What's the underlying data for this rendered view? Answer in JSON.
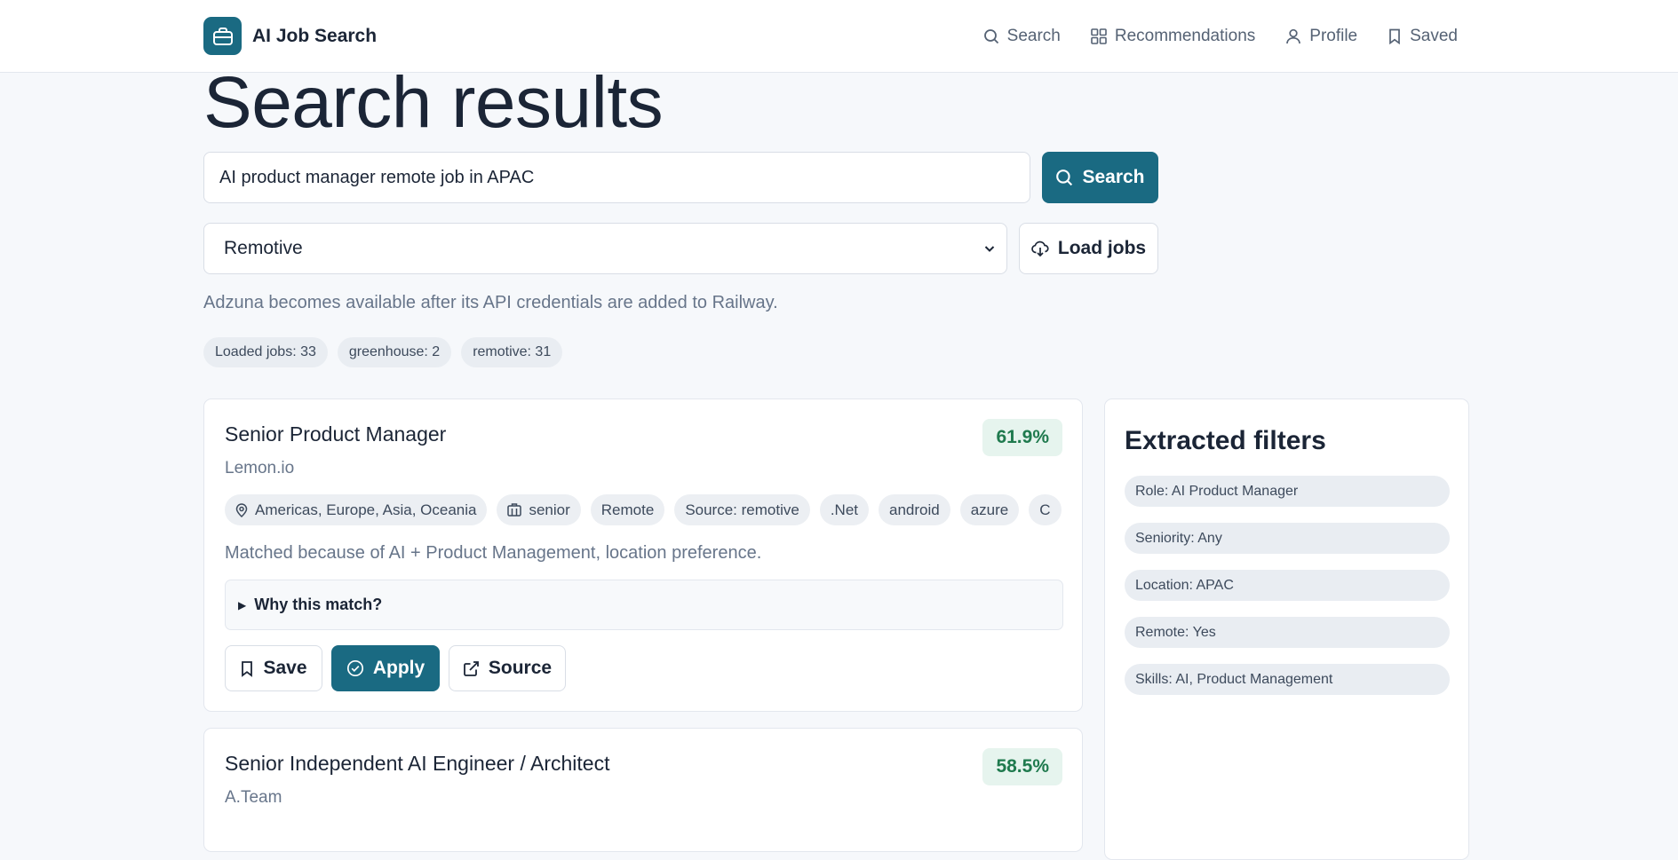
{
  "app": {
    "name": "AI Job Search"
  },
  "nav": {
    "items": [
      {
        "label": "Search",
        "icon": "search-icon"
      },
      {
        "label": "Recommendations",
        "icon": "grid-icon"
      },
      {
        "label": "Profile",
        "icon": "user-icon"
      },
      {
        "label": "Saved",
        "icon": "bookmark-icon"
      }
    ]
  },
  "page": {
    "title": "Search results"
  },
  "search": {
    "value": "AI product manager remote job in APAC",
    "button_label": "Search"
  },
  "source": {
    "selected": "Remotive",
    "load_label": "Load jobs"
  },
  "note": "Adzuna becomes available after its API credentials are added to Railway.",
  "stats": [
    "Loaded jobs: 33",
    "greenhouse: 2",
    "remotive: 31"
  ],
  "jobs": [
    {
      "title": "Senior Product Manager",
      "company": "Lemon.io",
      "score": "61.9%",
      "location": "Americas, Europe, Asia, Oceania",
      "seniority": "senior",
      "tags": [
        "Remote",
        "Source: remotive",
        ".Net",
        "android",
        "azure",
        "C"
      ],
      "reason": "Matched because of AI + Product Management, location preference.",
      "why_label": "Why this match?",
      "actions": {
        "save": "Save",
        "apply": "Apply",
        "source": "Source"
      }
    },
    {
      "title": "Senior Independent AI Engineer / Architect",
      "company": "A.Team",
      "score": "58.5%"
    }
  ],
  "filters": {
    "title": "Extracted filters",
    "items": [
      "Role: AI Product Manager",
      "Seniority: Any",
      "Location: APAC",
      "Remote: Yes",
      "Skills: AI, Product Management"
    ]
  },
  "colors": {
    "accent": "#1a6a82",
    "score_bg": "#e6f4ee",
    "score_text": "#1f7a4e"
  }
}
